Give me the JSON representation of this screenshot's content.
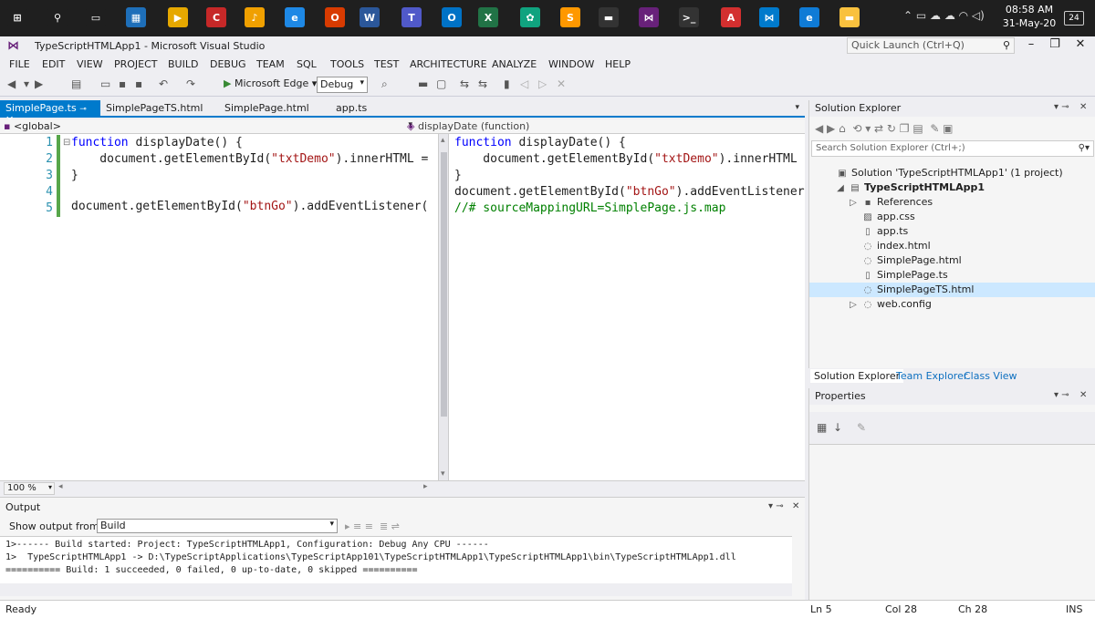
{
  "taskbar": {
    "icons": [
      {
        "name": "windows-start-icon",
        "glyph": "⊞",
        "color": "#1f1f1f"
      },
      {
        "name": "search-icon",
        "glyph": "⚲",
        "color": "#1f1f1f"
      },
      {
        "name": "task-view-icon",
        "glyph": "▭",
        "color": "#1f1f1f"
      },
      {
        "name": "desktop-icon",
        "glyph": "▦",
        "color": "#1e6fb9"
      },
      {
        "name": "player-icon",
        "glyph": "▶",
        "color": "#e6a800"
      },
      {
        "name": "chrome-red-icon",
        "glyph": "C",
        "color": "#c62828"
      },
      {
        "name": "player-app-icon",
        "glyph": "♪",
        "color": "#f0a000"
      },
      {
        "name": "edge-blue-icon",
        "glyph": "e",
        "color": "#1e88e5"
      },
      {
        "name": "office-icon",
        "glyph": "O",
        "color": "#d83b01"
      },
      {
        "name": "word-icon",
        "glyph": "W",
        "color": "#2b579a"
      },
      {
        "name": "teams-icon",
        "glyph": "T",
        "color": "#5059c9"
      },
      {
        "name": "outlook-icon",
        "glyph": "O",
        "color": "#0072c6"
      },
      {
        "name": "excel-icon",
        "glyph": "X",
        "color": "#217346"
      },
      {
        "name": "openai-icon",
        "glyph": "✿",
        "color": "#10a37f"
      },
      {
        "name": "sublime-icon",
        "glyph": "S",
        "color": "#ff9800"
      },
      {
        "name": "pdf-tool-icon",
        "glyph": "▬",
        "color": "#333333"
      },
      {
        "name": "visual-studio-icon",
        "glyph": "⋈",
        "color": "#68217a"
      },
      {
        "name": "terminal-icon",
        "glyph": ">_",
        "color": "#333333"
      },
      {
        "name": "acrobat-icon",
        "glyph": "A",
        "color": "#d32f2f"
      },
      {
        "name": "vscode-icon",
        "glyph": "⋈",
        "color": "#007acc"
      },
      {
        "name": "edge-icon",
        "glyph": "e",
        "color": "#0f7bd6"
      },
      {
        "name": "file-explorer-icon",
        "glyph": "▬",
        "color": "#f9c13e"
      }
    ],
    "time": "08:58 AM",
    "date": "31-May-20",
    "notification_count": "24"
  },
  "window": {
    "title": "TypeScriptHTMLApp1 - Microsoft Visual Studio",
    "quick_launch_placeholder": "Quick Launch (Ctrl+Q)"
  },
  "menu": [
    "FILE",
    "EDIT",
    "VIEW",
    "PROJECT",
    "BUILD",
    "DEBUG",
    "TEAM",
    "SQL",
    "TOOLS",
    "TEST",
    "ARCHITECTURE",
    "ANALYZE",
    "WINDOW",
    "HELP"
  ],
  "toolbar": {
    "run_target": "Microsoft Edge",
    "configuration": "Debug"
  },
  "tabs": [
    "SimplePage.ts",
    "SimplePageTS.html",
    "SimplePage.html",
    "app.ts"
  ],
  "navbar": {
    "scope": "<global>",
    "member": "displayDate (function)"
  },
  "editor_left": {
    "line_numbers": [
      "1",
      "2",
      "3",
      "4",
      "5"
    ],
    "lines": [
      [
        [
          "kw",
          "function"
        ],
        [
          "txt",
          " displayDate() {"
        ]
      ],
      [
        [
          "txt",
          "    document.getElementById("
        ],
        [
          "str",
          "\"txtDemo\""
        ],
        [
          "txt",
          ").innerHTML ="
        ]
      ],
      [
        [
          "txt",
          "}"
        ]
      ],
      [
        [
          "txt",
          ""
        ]
      ],
      [
        [
          "txt",
          "document.getElementById("
        ],
        [
          "str",
          "\"btnGo\""
        ],
        [
          "txt",
          ").addEventListener("
        ]
      ]
    ]
  },
  "editor_right": {
    "lines": [
      [
        [
          "kw",
          "function"
        ],
        [
          "txt",
          " displayDate() {"
        ]
      ],
      [
        [
          "txt",
          "    document.getElementById("
        ],
        [
          "str",
          "\"txtDemo\""
        ],
        [
          "txt",
          ").innerHTML"
        ]
      ],
      [
        [
          "txt",
          "}"
        ]
      ],
      [
        [
          "txt",
          "document.getElementById("
        ],
        [
          "str",
          "\"btnGo\""
        ],
        [
          "txt",
          ").addEventListener"
        ]
      ],
      [
        [
          "cmt",
          "//# sourceMappingURL=SimplePage.js.map"
        ]
      ]
    ]
  },
  "zoom": "100 %",
  "solution_explorer": {
    "title": "Solution Explorer",
    "search_placeholder": "Search Solution Explorer (Ctrl+;)",
    "items": [
      {
        "label": "Solution 'TypeScriptHTMLApp1' (1 project)",
        "indent": 0,
        "icon": "solution-icon",
        "glyph": "▣",
        "bold": false,
        "selected": false
      },
      {
        "label": "TypeScriptHTMLApp1",
        "indent": 1,
        "icon": "project-icon",
        "glyph": "▤",
        "bold": true,
        "selected": false,
        "expander": "◢"
      },
      {
        "label": "References",
        "indent": 2,
        "icon": "references-icon",
        "glyph": "▪",
        "bold": false,
        "selected": false,
        "expander": "▷"
      },
      {
        "label": "app.css",
        "indent": 2,
        "icon": "css-file-icon",
        "glyph": "▨",
        "bold": false,
        "selected": false
      },
      {
        "label": "app.ts",
        "indent": 2,
        "icon": "ts-file-icon",
        "glyph": "▯",
        "bold": false,
        "selected": false
      },
      {
        "label": "index.html",
        "indent": 2,
        "icon": "html-file-icon",
        "glyph": "◌",
        "bold": false,
        "selected": false
      },
      {
        "label": "SimplePage.html",
        "indent": 2,
        "icon": "html-file-icon",
        "glyph": "◌",
        "bold": false,
        "selected": false
      },
      {
        "label": "SimplePage.ts",
        "indent": 2,
        "icon": "ts-file-icon",
        "glyph": "▯",
        "bold": false,
        "selected": false
      },
      {
        "label": "SimplePageTS.html",
        "indent": 2,
        "icon": "html-file-icon",
        "glyph": "◌",
        "bold": false,
        "selected": true
      },
      {
        "label": "web.config",
        "indent": 2,
        "icon": "config-file-icon",
        "glyph": "◌",
        "bold": false,
        "selected": false,
        "expander": "▷"
      }
    ],
    "bottom_tabs": [
      "Solution Explorer",
      "Team Explorer",
      "Class View"
    ]
  },
  "properties": {
    "title": "Properties"
  },
  "output": {
    "title": "Output",
    "show_from_label": "Show output from:",
    "source": "Build",
    "lines": [
      "1>------ Build started: Project: TypeScriptHTMLApp1, Configuration: Debug Any CPU ------",
      "1>  TypeScriptHTMLApp1 -> D:\\TypeScriptApplications\\TypeScriptApp101\\TypeScriptHTMLApp1\\TypeScriptHTMLApp1\\bin\\TypeScriptHTMLApp1.dll",
      "========== Build: 1 succeeded, 0 failed, 0 up-to-date, 0 skipped =========="
    ]
  },
  "status": {
    "text": "Ready",
    "ln": "Ln 5",
    "col": "Col 28",
    "ch": "Ch 28",
    "mode": "INS"
  },
  "colors": {
    "accent": "#007acc",
    "keyword": "#0000ff",
    "string": "#a31515",
    "comment": "#008000",
    "line_number": "#2b91af"
  }
}
